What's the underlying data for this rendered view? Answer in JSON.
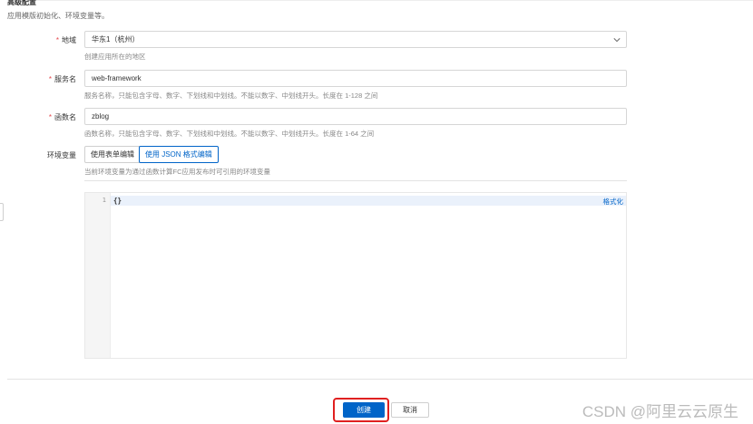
{
  "section": {
    "title": "高级配置",
    "subtitle": "应用模版初始化、环境变量等。"
  },
  "region": {
    "required_mark": "*",
    "label": "地域",
    "value": "华东1（杭州）",
    "hint": "创建应用所在的地区"
  },
  "service": {
    "required_mark": "*",
    "label": "服务名",
    "value": "web-framework",
    "hint": "服务名称，只能包含字母、数字、下划线和中划线。不能以数字、中划线开头。长度在 1-128 之间"
  },
  "function": {
    "required_mark": "*",
    "label": "函数名",
    "value": "zblog",
    "hint": "函数名称，只能包含字母、数字、下划线和中划线。不能以数字、中划线开头。长度在 1-64 之间"
  },
  "env": {
    "label": "环境变量",
    "tab_form": "使用表单编辑",
    "tab_json": "使用 JSON 格式编辑",
    "active_tab": "json",
    "hint": "当前环境变量为通过函数计算FC应用发布时可引用的环境变量"
  },
  "editor": {
    "line_number": "1",
    "content": "{}",
    "format_label": "格式化"
  },
  "footer": {
    "create_label": "创建",
    "cancel_label": "取消"
  },
  "watermark": "CSDN @阿里云云原生",
  "colors": {
    "primary": "#0064c8",
    "highlight": "#e02020",
    "required": "#e5484d"
  },
  "icons": {
    "select_arrow": "chevron-down-icon"
  }
}
